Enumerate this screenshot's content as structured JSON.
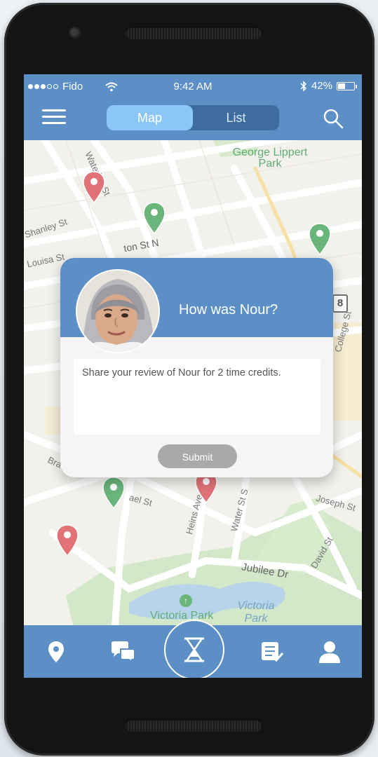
{
  "status": {
    "carrier": "Fido",
    "time": "9:42 AM",
    "battery": "42%"
  },
  "nav": {
    "tabs": [
      {
        "label": "Map",
        "active": true
      },
      {
        "label": "List",
        "active": false
      }
    ]
  },
  "map_labels": {
    "park_north": "George Lippert Park",
    "park_south": "Victoria Park",
    "water": "Victoria Park",
    "streets": {
      "waterloo": "Waterloo St",
      "shanley": "Shanley St",
      "louisa": "Louisa St",
      "weber": "ton St N",
      "college": "College St",
      "joseph": "Joseph St",
      "heins": "Heins Ave",
      "water_st": "Water St S",
      "david": "David St",
      "jubilee": "Jubilee Dr",
      "bramm": "Bra",
      "michael": "ael St"
    },
    "route_badge": "8"
  },
  "review": {
    "title": "How was Nour?",
    "placeholder": "Share your review of Nour for 2 time credits.",
    "submit_label": "Submit"
  },
  "colors": {
    "primary": "#5b8fc6",
    "pin_red": "#d9545b",
    "pin_green": "#4aa560",
    "submit_disabled": "#a9a9a9"
  },
  "tabbar": {
    "icons": [
      "map-marker-icon",
      "chat-icon",
      "hourglass-icon",
      "review-list-icon",
      "profile-icon"
    ]
  }
}
